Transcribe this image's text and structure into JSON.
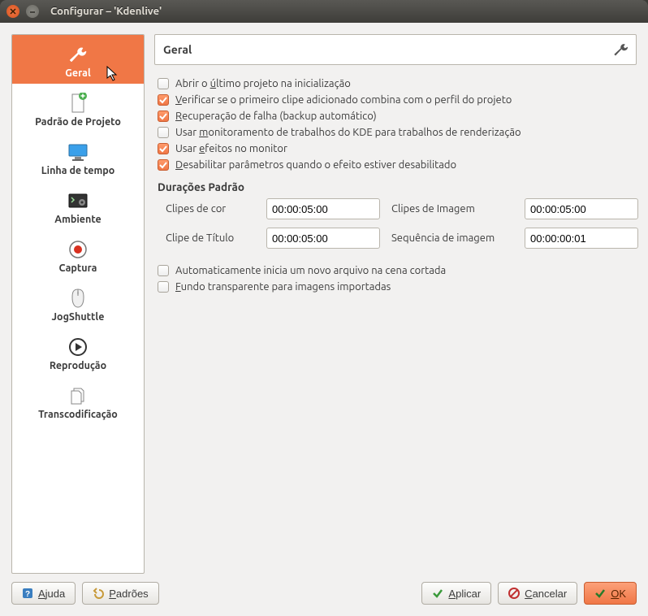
{
  "window": {
    "title": "Configurar – 'Kdenlive'"
  },
  "sidebar": {
    "items": [
      {
        "label": "Geral"
      },
      {
        "label": "Padrão de Projeto"
      },
      {
        "label": "Linha de tempo"
      },
      {
        "label": "Ambiente"
      },
      {
        "label": "Captura"
      },
      {
        "label": "JogShuttle"
      },
      {
        "label": "Reprodução"
      },
      {
        "label": "Transcodificação"
      }
    ]
  },
  "header": {
    "title": "Geral"
  },
  "checkboxes": {
    "open_last": {
      "checked": false,
      "label_pre": "Abrir o ",
      "u": "ú",
      "label_post": "ltimo projeto na inicialização"
    },
    "verify_profile": {
      "checked": true,
      "u": "V",
      "label_post": "erificar se o primeiro clipe adicionado combina com o perfil do projeto"
    },
    "crash_recovery": {
      "checked": true,
      "u": "R",
      "label_post": "ecuperação de falha (backup automático)"
    },
    "kde_jobs": {
      "checked": false,
      "label_pre": "Usar ",
      "u": "m",
      "label_post": "onitoramento de trabalhos do KDE para trabalhos de renderização"
    },
    "monitor_effects": {
      "checked": true,
      "label_pre": "Usar ",
      "u": "e",
      "label_post": "feitos no monitor"
    },
    "disable_params": {
      "checked": true,
      "u": "D",
      "label_post": "esabilitar parâmetros quando o efeito estiver desabilitado"
    },
    "auto_new_file": {
      "checked": false,
      "label": "Automaticamente inicia um novo arquivo na cena cortada"
    },
    "transparent_bg": {
      "checked": false,
      "u": "F",
      "label_post": "undo transparente para imagens importadas"
    }
  },
  "durations": {
    "heading": "Durações Padrão",
    "color_label": "Clipes de cor",
    "color_value": "00:00:05:00",
    "image_label": "Clipes de Imagem",
    "image_value": "00:00:05:00",
    "title_label": "Clipe de Título",
    "title_value": "00:00:05:00",
    "seq_label": "Sequência de imagem",
    "seq_value": "00:00:00:01"
  },
  "footer": {
    "help": "Ajuda",
    "defaults": "Padrões",
    "apply": "Aplicar",
    "cancel": "Cancelar",
    "ok": "OK",
    "ok_u": "O",
    "ok_post": "K",
    "cancel_u": "C",
    "cancel_post": "ancelar",
    "apply_u": "A",
    "apply_post": "plicar",
    "defaults_u": "P",
    "defaults_post": "adrões",
    "help_u": "A",
    "help_post": "juda"
  }
}
